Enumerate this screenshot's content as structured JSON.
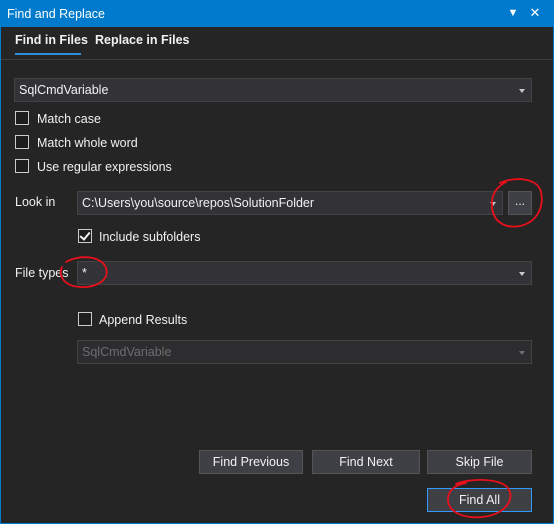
{
  "window": {
    "title": "Find and Replace",
    "pin_icon": "pin-dropdown-icon",
    "close_icon": "close-icon"
  },
  "tabs": [
    {
      "label": "Find in Files",
      "active": true
    },
    {
      "label": "Replace in Files",
      "active": false
    }
  ],
  "search": {
    "value": "SqlCmdVariable"
  },
  "options": {
    "match_case": {
      "label": "Match case",
      "checked": false
    },
    "match_whole_word": {
      "label": "Match whole word",
      "checked": false
    },
    "use_regex": {
      "label": "Use regular expressions",
      "checked": false
    }
  },
  "look_in": {
    "label": "Look in",
    "value": "C:\\Users\\you\\source\\repos\\SolutionFolder",
    "browse_label": "...",
    "include_subfolders": {
      "label": "Include subfolders",
      "checked": true
    }
  },
  "file_types": {
    "label": "File types",
    "value": "*"
  },
  "append_results": {
    "label": "Append Results",
    "checked": false,
    "target_value": "SqlCmdVariable",
    "target_enabled": false
  },
  "buttons": {
    "find_previous": "Find Previous",
    "find_next": "Find Next",
    "skip_file": "Skip File",
    "find_all": "Find All"
  },
  "colors": {
    "accent": "#007acc",
    "annotation": "#e8101a"
  }
}
